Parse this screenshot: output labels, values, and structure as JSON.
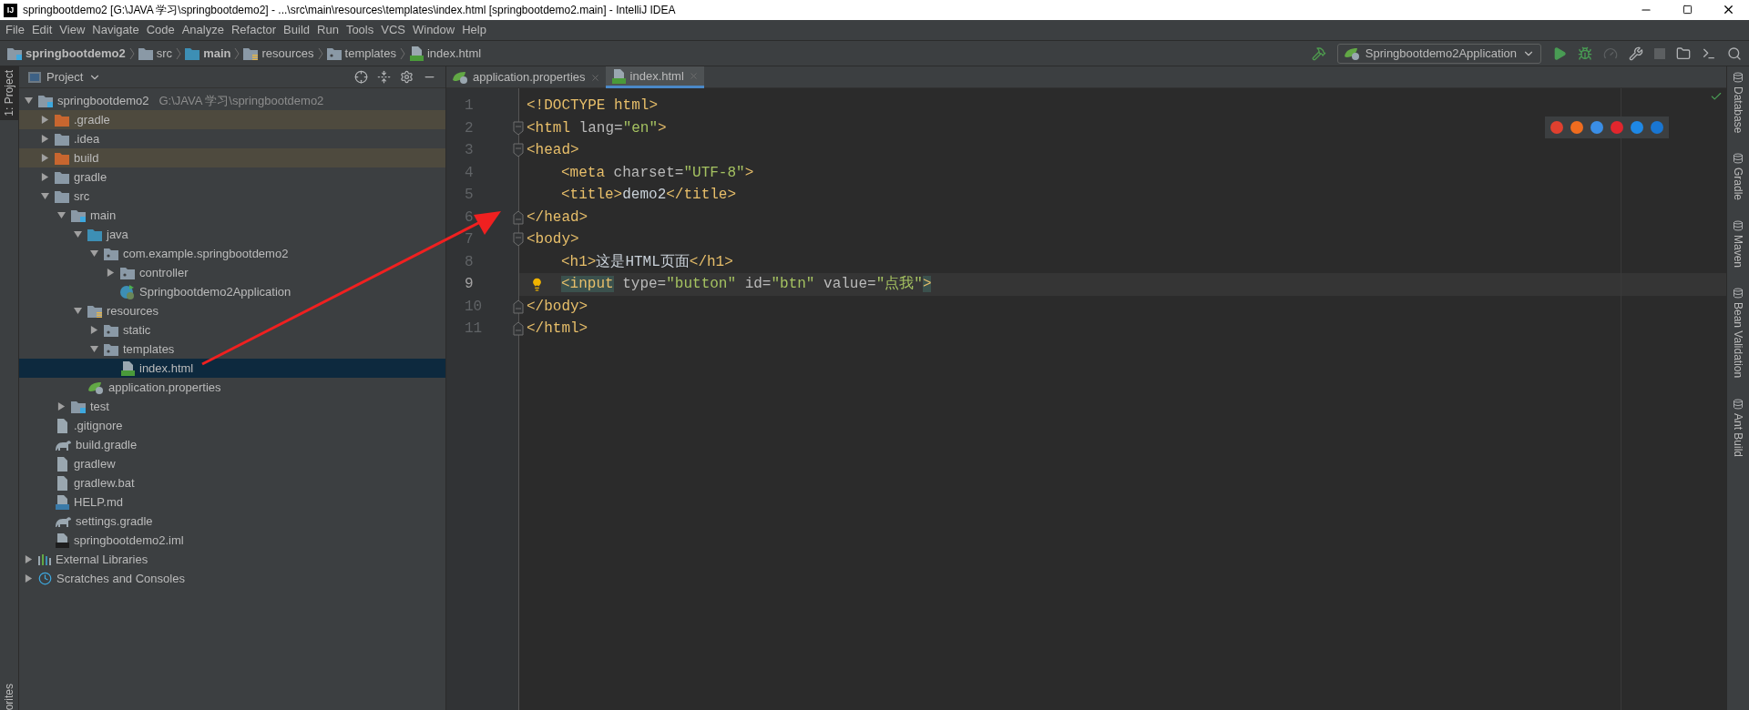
{
  "window": {
    "title": "springbootdemo2 [G:\\JAVA 学习\\springbootdemo2] - ...\\src\\main\\resources\\templates\\index.html [springbootdemo2.main] - IntelliJ IDEA",
    "logo": "IJ"
  },
  "menu": [
    "File",
    "Edit",
    "View",
    "Navigate",
    "Code",
    "Analyze",
    "Refactor",
    "Build",
    "Run",
    "Tools",
    "VCS",
    "Window",
    "Help"
  ],
  "breadcrumbs": [
    {
      "label": "springbootdemo2",
      "kind": "module"
    },
    {
      "label": "src",
      "kind": "folder"
    },
    {
      "label": "main",
      "kind": "source-root"
    },
    {
      "label": "resources",
      "kind": "resources"
    },
    {
      "label": "templates",
      "kind": "package"
    },
    {
      "label": "index.html",
      "kind": "html"
    }
  ],
  "run_config": {
    "label": "Springbootdemo2Application"
  },
  "left_strip": {
    "project_tab": "1: Project",
    "favorites_tab": "orites"
  },
  "project_panel": {
    "title": "Project",
    "tree": [
      {
        "label": "springbootdemo2",
        "path": "G:\\JAVA 学习\\springbootdemo2",
        "kind": "module",
        "expanded": true,
        "selected": false,
        "excluded": false,
        "children": [
          {
            "label": ".gradle",
            "kind": "folder",
            "expanded": false,
            "selected": false,
            "excluded": true
          },
          {
            "label": ".idea",
            "kind": "folder",
            "expanded": false,
            "selected": false,
            "excluded": false
          },
          {
            "label": "build",
            "kind": "folder",
            "expanded": false,
            "selected": false,
            "excluded": true
          },
          {
            "label": "gradle",
            "kind": "folder",
            "expanded": false,
            "selected": false,
            "excluded": false
          },
          {
            "label": "src",
            "kind": "folder",
            "expanded": true,
            "selected": false,
            "excluded": false,
            "children": [
              {
                "label": "main",
                "kind": "module-folder",
                "expanded": true,
                "selected": false,
                "excluded": false,
                "children": [
                  {
                    "label": "java",
                    "kind": "source-root",
                    "expanded": true,
                    "selected": false,
                    "excluded": false,
                    "children": [
                      {
                        "label": "com.example.springbootdemo2",
                        "kind": "package",
                        "expanded": true,
                        "selected": false,
                        "excluded": false,
                        "children": [
                          {
                            "label": "controller",
                            "kind": "package",
                            "expanded": false,
                            "selected": false,
                            "excluded": false
                          },
                          {
                            "label": "Springbootdemo2Application",
                            "kind": "spring",
                            "selected": false,
                            "excluded": false
                          }
                        ]
                      }
                    ]
                  },
                  {
                    "label": "resources",
                    "kind": "resources",
                    "expanded": true,
                    "selected": false,
                    "excluded": false,
                    "children": [
                      {
                        "label": "static",
                        "kind": "package",
                        "expanded": false,
                        "selected": false,
                        "excluded": false
                      },
                      {
                        "label": "templates",
                        "kind": "package",
                        "expanded": true,
                        "selected": false,
                        "excluded": false,
                        "children": [
                          {
                            "label": "index.html",
                            "kind": "html",
                            "selected": true,
                            "excluded": false
                          }
                        ]
                      }
                    ]
                  },
                  {
                    "label": "application.properties",
                    "kind": "properties",
                    "selected": false,
                    "excluded": false
                  }
                ]
              },
              {
                "label": "test",
                "kind": "module-folder",
                "expanded": false,
                "selected": false,
                "excluded": false
              }
            ]
          },
          {
            "label": ".gitignore",
            "kind": "text",
            "selected": false,
            "excluded": false
          },
          {
            "label": "build.gradle",
            "kind": "gradle",
            "selected": false,
            "excluded": false
          },
          {
            "label": "gradlew",
            "kind": "text",
            "selected": false,
            "excluded": false
          },
          {
            "label": "gradlew.bat",
            "kind": "text",
            "selected": false,
            "excluded": false
          },
          {
            "label": "HELP.md",
            "kind": "markdown",
            "selected": false,
            "excluded": false
          },
          {
            "label": "settings.gradle",
            "kind": "gradle",
            "selected": false,
            "excluded": false
          },
          {
            "label": "springbootdemo2.iml",
            "kind": "iml",
            "selected": false,
            "excluded": false
          }
        ]
      },
      {
        "label": "External Libraries",
        "kind": "libraries",
        "expanded": false,
        "selected": false,
        "excluded": false
      },
      {
        "label": "Scratches and Consoles",
        "kind": "scratches",
        "expanded": false,
        "selected": false,
        "excluded": false
      }
    ]
  },
  "tabs": [
    {
      "label": "application.properties",
      "kind": "properties",
      "selected": false
    },
    {
      "label": "index.html",
      "kind": "html",
      "selected": true
    }
  ],
  "code_lines": [
    {
      "number": "1",
      "kind": "plain",
      "indented": false,
      "current": false,
      "segments": [
        {
          "text": "<!DOCTYPE html>",
          "kind": "tag",
          "highlighted": false
        }
      ]
    },
    {
      "number": "2",
      "kind": "fold-start",
      "indented": false,
      "current": false,
      "segments": [
        {
          "text": "<html ",
          "kind": "tag",
          "highlighted": false
        },
        {
          "text": "lang=",
          "kind": "attr",
          "highlighted": false
        },
        {
          "text": "\"en\"",
          "kind": "value",
          "highlighted": false
        },
        {
          "text": ">",
          "kind": "tag",
          "highlighted": false
        }
      ]
    },
    {
      "number": "3",
      "kind": "fold-start",
      "indented": false,
      "current": false,
      "segments": [
        {
          "text": "<head>",
          "kind": "tag",
          "highlighted": false
        }
      ]
    },
    {
      "number": "4",
      "kind": "plain",
      "indented": true,
      "current": false,
      "segments": [
        {
          "text": "<meta ",
          "kind": "tag",
          "highlighted": false
        },
        {
          "text": "charset=",
          "kind": "attr",
          "highlighted": false
        },
        {
          "text": "\"UTF-8\"",
          "kind": "value",
          "highlighted": false
        },
        {
          "text": ">",
          "kind": "tag",
          "highlighted": false
        }
      ]
    },
    {
      "number": "5",
      "kind": "plain",
      "indented": true,
      "current": false,
      "segments": [
        {
          "text": "<title>",
          "kind": "tag",
          "highlighted": false
        },
        {
          "text": "demo2",
          "kind": "text",
          "highlighted": false
        },
        {
          "text": "</title>",
          "kind": "tag",
          "highlighted": false
        }
      ]
    },
    {
      "number": "6",
      "kind": "fold-end",
      "indented": false,
      "current": false,
      "segments": [
        {
          "text": "</head>",
          "kind": "tag",
          "highlighted": false
        }
      ]
    },
    {
      "number": "7",
      "kind": "fold-start",
      "indented": false,
      "current": false,
      "segments": [
        {
          "text": "<body>",
          "kind": "tag",
          "highlighted": false
        }
      ]
    },
    {
      "number": "8",
      "kind": "plain",
      "indented": true,
      "current": false,
      "segments": [
        {
          "text": "<h1>",
          "kind": "tag",
          "highlighted": false
        },
        {
          "text": "这是HTML页面",
          "kind": "text",
          "highlighted": false
        },
        {
          "text": "</h1>",
          "kind": "tag",
          "highlighted": false
        }
      ]
    },
    {
      "number": "9",
      "kind": "plain",
      "indented": true,
      "current": true,
      "bulb": true,
      "segments": [
        {
          "text": "<input",
          "kind": "tag",
          "highlighted": true
        },
        {
          "text": " type=",
          "kind": "attr",
          "highlighted": false
        },
        {
          "text": "\"button\"",
          "kind": "value",
          "highlighted": false
        },
        {
          "text": " id=",
          "kind": "attr",
          "highlighted": false
        },
        {
          "text": "\"btn\"",
          "kind": "value",
          "highlighted": false
        },
        {
          "text": " value=",
          "kind": "attr",
          "highlighted": false
        },
        {
          "text": "\"点我\"",
          "kind": "value",
          "highlighted": false
        },
        {
          "text": ">",
          "kind": "tag",
          "highlighted": true
        }
      ]
    },
    {
      "number": "10",
      "kind": "fold-end",
      "indented": false,
      "current": false,
      "segments": [
        {
          "text": "</body>",
          "kind": "tag",
          "highlighted": false
        }
      ]
    },
    {
      "number": "11",
      "kind": "fold-end",
      "indented": false,
      "current": false,
      "segments": [
        {
          "text": "</html>",
          "kind": "tag",
          "highlighted": false
        }
      ]
    }
  ],
  "browsers": [
    {
      "color": "#e0402f"
    },
    {
      "color": "#ef6c1f"
    },
    {
      "color": "#3a8ee6"
    },
    {
      "color": "#e1262d"
    },
    {
      "color": "#1e88e5"
    },
    {
      "color": "#1976d2"
    }
  ],
  "right_strip": [
    "Database",
    "Gradle",
    "Maven",
    "Bean Validation",
    "Ant Build"
  ]
}
